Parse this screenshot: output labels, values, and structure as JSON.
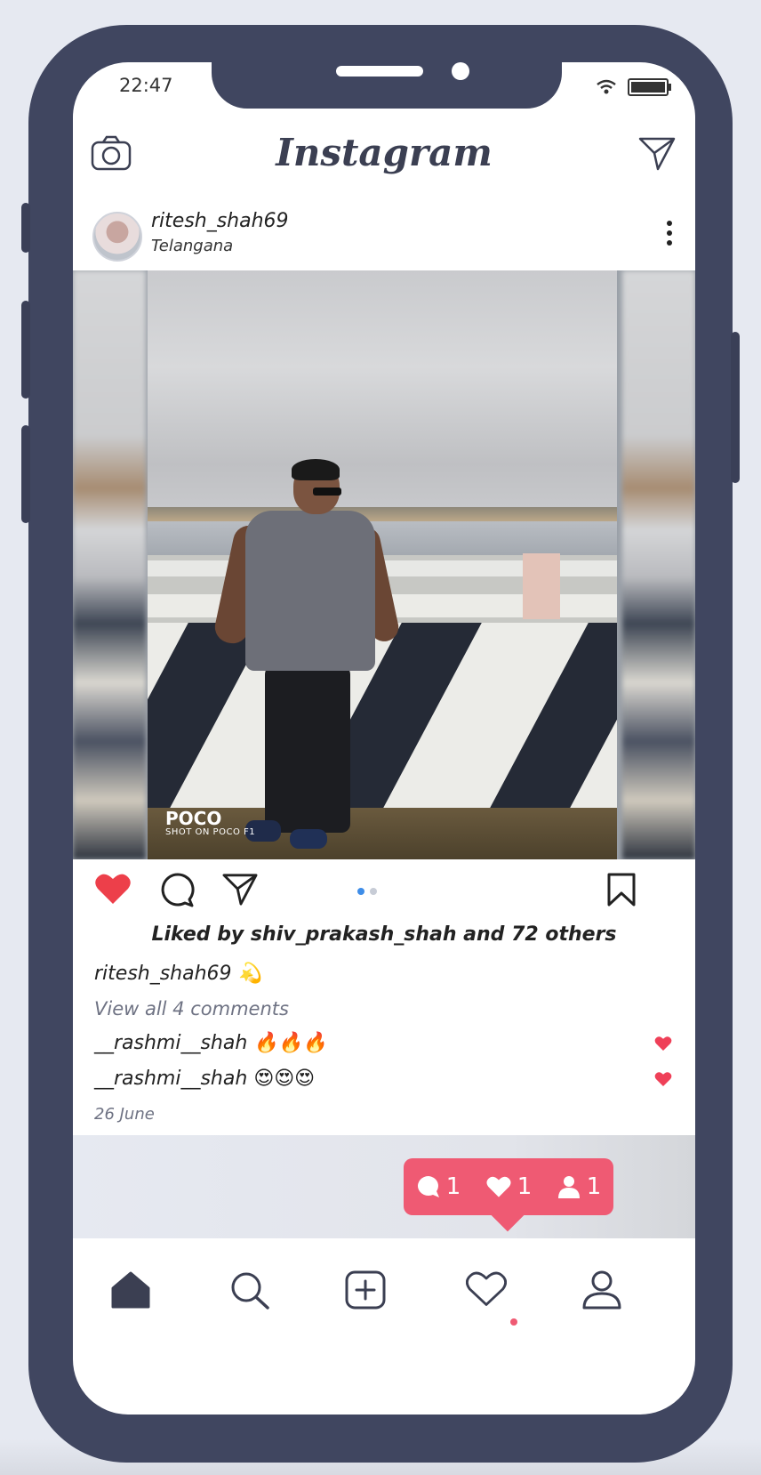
{
  "status_bar": {
    "time": "22:47",
    "wifi_icon": "wifi-icon",
    "battery_icon": "battery-icon"
  },
  "header": {
    "title": "Instagram",
    "left_icon": "camera-icon",
    "right_icon": "direct-message-icon"
  },
  "post": {
    "username": "ritesh_shah69",
    "location": "Telangana",
    "photo_watermark": {
      "brand": "POCO",
      "subtitle": "SHOT ON POCO F1"
    },
    "carousel": {
      "count": 2,
      "active_index": 0
    },
    "liked": true,
    "likes_text": "Liked by shiv_prakash_shah and 72 others",
    "caption": {
      "username": "ritesh_shah69",
      "text": "💫"
    },
    "view_all_comments": "View all 4 comments",
    "comments": [
      {
        "username": "__rashmi__shah",
        "text": "🔥🔥🔥"
      },
      {
        "username": "__rashmi__shah",
        "text": "😍😍😍"
      }
    ],
    "date": "26 June"
  },
  "notification_badge": {
    "comments": "1",
    "likes": "1",
    "followers": "1"
  },
  "tabbar": {
    "items": [
      "home",
      "search",
      "new-post",
      "activity",
      "profile"
    ],
    "active": "home"
  },
  "colors": {
    "accent": "#ef5a73",
    "phone_frame": "#404660",
    "like": "#ed3f4a",
    "carousel_active": "#3e8de8"
  }
}
